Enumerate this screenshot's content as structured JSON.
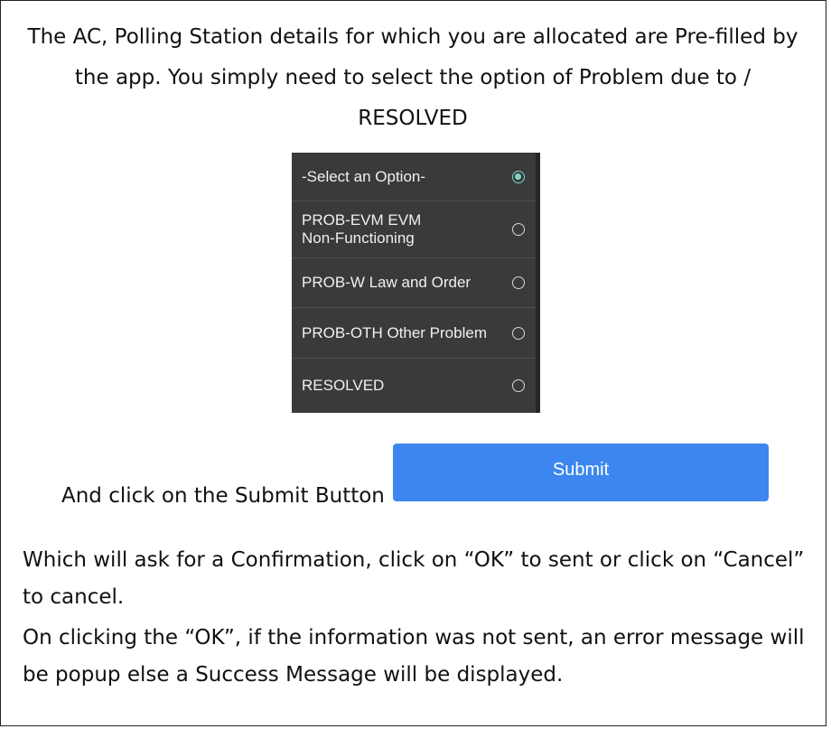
{
  "intro_text": "The AC, Polling Station details for which you are allocated are Pre-filled by the app. You simply need to select the option of Problem due to / RESOLVED",
  "options": [
    {
      "label": "-Select an Option-",
      "selected": true
    },
    {
      "label": "PROB-EVM EVM\nNon-Functioning",
      "selected": false
    },
    {
      "label": "PROB-W Law and Order",
      "selected": false
    },
    {
      "label": "PROB-OTH Other Problem",
      "selected": false
    },
    {
      "label": "RESOLVED",
      "selected": false
    }
  ],
  "submit_caption": "And click on the Submit Button",
  "submit_label": "Submit",
  "confirmation_text": "Which will ask for a Confirmation, click on “OK” to sent or click on “Cancel” to cancel.",
  "result_text": "On clicking the “OK”, if the information was not sent, an error message will be popup else a Success Message will be displayed.",
  "colors": {
    "panel_bg": "#3a3a3a",
    "selected_radio": "#7fd3c8",
    "submit_bg": "#3d86f0"
  }
}
